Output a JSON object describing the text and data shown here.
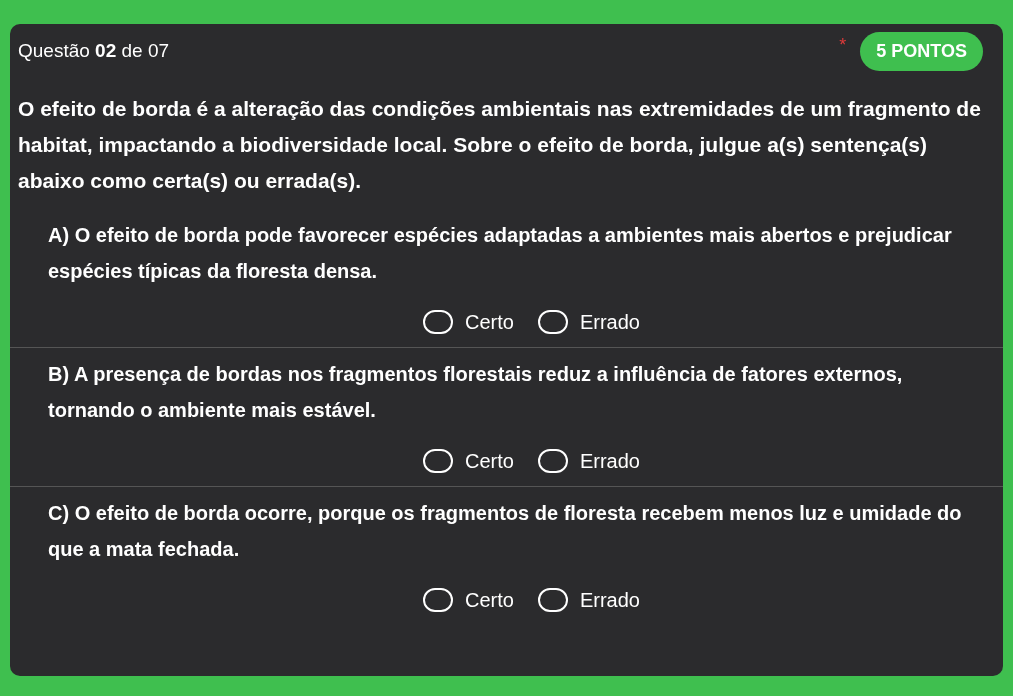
{
  "header": {
    "title": "Questão **02** de 07",
    "required_mark": "*",
    "points": "5 PONTOS"
  },
  "statement": "O efeito de borda é a alteração das condições ambientais nas extremidades de um fragmento de habitat, impactando a biodiversidade local. Sobre o efeito de borda, julgue a(s) sentença(s) abaixo como certa(s) ou errada(s).",
  "items": [
    {
      "text": "A) O efeito de borda pode favorecer espécies adaptadas a ambientes mais abertos e prejudicar espécies típicas da floresta densa.",
      "options": [
        {
          "label": "Certo",
          "selected": false
        },
        {
          "label": "Errado",
          "selected": false
        }
      ]
    },
    {
      "text": "B) A presença de bordas nos fragmentos florestais reduz a influência de fatores externos, tornando o ambiente mais estável.",
      "options": [
        {
          "label": "Certo",
          "selected": false
        },
        {
          "label": "Errado",
          "selected": false
        }
      ]
    },
    {
      "text": "C) O efeito de borda ocorre, porque os fragmentos de floresta recebem menos luz e umidade do que a mata fechada.",
      "options": [
        {
          "label": "Certo",
          "selected": false
        },
        {
          "label": "Errado",
          "selected": false
        }
      ]
    }
  ]
}
